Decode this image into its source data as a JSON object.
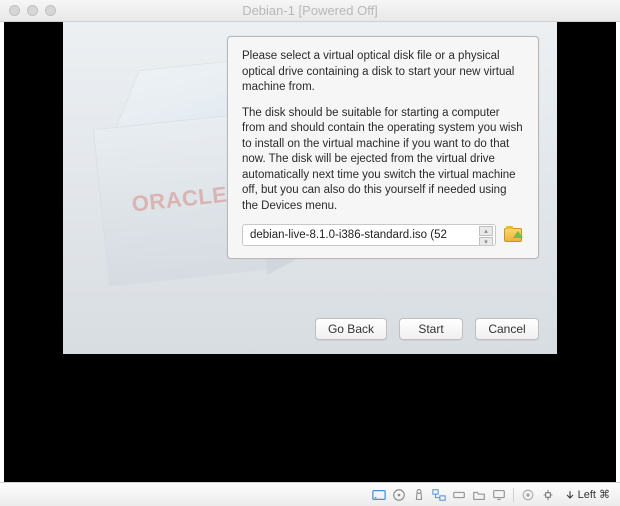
{
  "window": {
    "title": "Debian-1 [Powered Off]"
  },
  "dialog": {
    "para1": "Please select a virtual optical disk file or a physical optical drive containing a disk to start your new virtual machine from.",
    "para2": "The disk should be suitable for starting a computer from and should contain the operating system you wish to install on the virtual machine if you want to do that now. The disk will be ejected from the virtual drive automatically next time you switch the virtual machine off, but you can also do this yourself if needed using the Devices menu.",
    "selected_disk": "debian-live-8.1.0-i386-standard.iso (52"
  },
  "buttons": {
    "back": "Go Back",
    "start": "Start",
    "cancel": "Cancel"
  },
  "brand": {
    "oracle": "ORACLE"
  },
  "statusbar": {
    "host_key": "Left ⌘"
  }
}
